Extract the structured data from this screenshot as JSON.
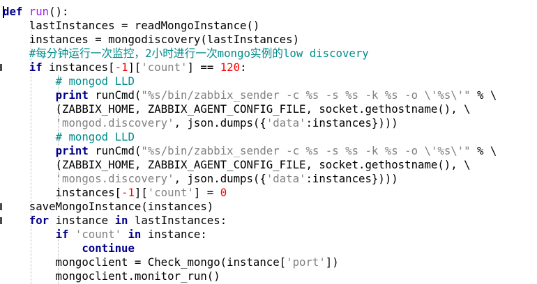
{
  "lines": [
    {
      "tokens": [
        {
          "t": "def",
          "k": "kw"
        },
        {
          "t": " "
        },
        {
          "t": "run",
          "k": "fn"
        },
        {
          "t": "():"
        }
      ]
    },
    {
      "tokens": [
        {
          "t": "    lastInstances = readMongoInstance()"
        }
      ]
    },
    {
      "tokens": [
        {
          "t": "    instances = mongodiscovery(lastInstances)"
        }
      ]
    },
    {
      "tokens": [
        {
          "t": "    "
        },
        {
          "t": "#每分钟运行一次监控，2小时进行一次mongo实例的low discovery",
          "k": "cmt"
        }
      ]
    },
    {
      "tokens": [
        {
          "t": "    "
        },
        {
          "t": "if",
          "k": "kw"
        },
        {
          "t": " instances["
        },
        {
          "t": "-1",
          "k": "num"
        },
        {
          "t": "]["
        },
        {
          "t": "'count'",
          "k": "str"
        },
        {
          "t": "] == "
        },
        {
          "t": "120",
          "k": "num"
        },
        {
          "t": ":"
        }
      ]
    },
    {
      "tokens": [
        {
          "t": "        "
        },
        {
          "t": "# mongod LLD",
          "k": "cmt"
        }
      ]
    },
    {
      "tokens": [
        {
          "t": "        "
        },
        {
          "t": "print",
          "k": "kw"
        },
        {
          "t": " runCmd("
        },
        {
          "t": "\"%s/bin/zabbix_sender -c %s -s %s -k %s -o \\'%s\\'\"",
          "k": "str"
        },
        {
          "t": " % \\"
        }
      ]
    },
    {
      "tokens": [
        {
          "t": "        (ZABBIX_HOME, ZABBIX_AGENT_CONFIG_FILE, socket.gethostname(), \\"
        }
      ]
    },
    {
      "tokens": [
        {
          "t": "        "
        },
        {
          "t": "'mongod.discovery'",
          "k": "str"
        },
        {
          "t": ", json.dumps({"
        },
        {
          "t": "'data'",
          "k": "str"
        },
        {
          "t": ":instances})))"
        }
      ]
    },
    {
      "tokens": [
        {
          "t": "        "
        },
        {
          "t": "# mongod LLD",
          "k": "cmt"
        }
      ]
    },
    {
      "tokens": [
        {
          "t": "        "
        },
        {
          "t": "print",
          "k": "kw"
        },
        {
          "t": " runCmd("
        },
        {
          "t": "\"%s/bin/zabbix_sender -c %s -s %s -k %s -o \\'%s\\'\"",
          "k": "str"
        },
        {
          "t": " % \\"
        }
      ]
    },
    {
      "tokens": [
        {
          "t": "        (ZABBIX_HOME, ZABBIX_AGENT_CONFIG_FILE, socket.gethostname(), \\"
        }
      ]
    },
    {
      "tokens": [
        {
          "t": "        "
        },
        {
          "t": "'mongos.discovery'",
          "k": "str"
        },
        {
          "t": ", json.dumps({"
        },
        {
          "t": "'data'",
          "k": "str"
        },
        {
          "t": ":instances})))"
        }
      ]
    },
    {
      "tokens": [
        {
          "t": "        instances["
        },
        {
          "t": "-1",
          "k": "num"
        },
        {
          "t": "]["
        },
        {
          "t": "'count'",
          "k": "str"
        },
        {
          "t": "] = "
        },
        {
          "t": "0",
          "k": "num"
        }
      ]
    },
    {
      "tokens": [
        {
          "t": "    saveMongoInstance(instances)"
        }
      ]
    },
    {
      "tokens": [
        {
          "t": "    "
        },
        {
          "t": "for",
          "k": "kw"
        },
        {
          "t": " instance "
        },
        {
          "t": "in",
          "k": "kw"
        },
        {
          "t": " lastInstances:"
        }
      ]
    },
    {
      "tokens": [
        {
          "t": "        "
        },
        {
          "t": "if",
          "k": "kw"
        },
        {
          "t": " "
        },
        {
          "t": "'count'",
          "k": "str"
        },
        {
          "t": " "
        },
        {
          "t": "in",
          "k": "kw"
        },
        {
          "t": " instance:"
        }
      ]
    },
    {
      "tokens": [
        {
          "t": "            "
        },
        {
          "t": "continue",
          "k": "kw"
        }
      ]
    },
    {
      "tokens": [
        {
          "t": "        mongoclient = Check_mongo(instance["
        },
        {
          "t": "'port'",
          "k": "str"
        },
        {
          "t": "])"
        }
      ]
    },
    {
      "tokens": [
        {
          "t": "        mongoclient.monitor_run()"
        }
      ]
    }
  ],
  "colors": {
    "keyword": "#00008b",
    "function_name": "#a020f0",
    "number": "#ff0000",
    "string": "#808080",
    "comment": "#008b8b",
    "text": "#000000",
    "background": "#ffffff"
  }
}
